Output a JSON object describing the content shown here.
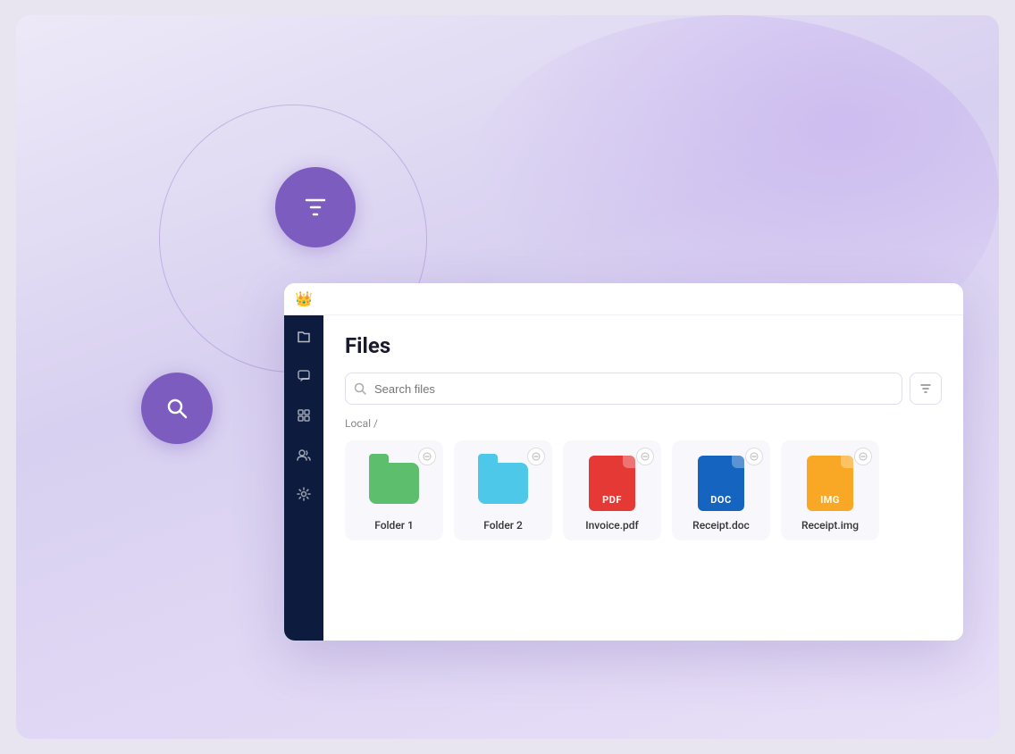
{
  "app": {
    "title": "Files",
    "breadcrumb": "Local /",
    "search_placeholder": "Search files"
  },
  "sidebar": {
    "items": [
      {
        "name": "files-icon",
        "symbol": "🗋"
      },
      {
        "name": "chat-icon",
        "symbol": "💬"
      },
      {
        "name": "grid-icon",
        "symbol": "⊞"
      },
      {
        "name": "users-icon",
        "symbol": "👥"
      },
      {
        "name": "settings-icon",
        "symbol": "⚙"
      }
    ]
  },
  "files": [
    {
      "id": "folder1",
      "name": "Folder 1",
      "type": "folder-green"
    },
    {
      "id": "folder2",
      "name": "Folder 2",
      "type": "folder-cyan"
    },
    {
      "id": "invoice",
      "name": "Invoice.pdf",
      "type": "pdf",
      "label": "PDF"
    },
    {
      "id": "receipt-doc",
      "name": "Receipt.doc",
      "type": "doc",
      "label": "DOC"
    },
    {
      "id": "receipt-img",
      "name": "Receipt.img",
      "type": "img",
      "label": "IMG"
    }
  ],
  "colors": {
    "sidebar_bg": "#0d1b3e",
    "purple_deco": "#7c5cbf",
    "crown_blue": "#3b6fe8"
  }
}
